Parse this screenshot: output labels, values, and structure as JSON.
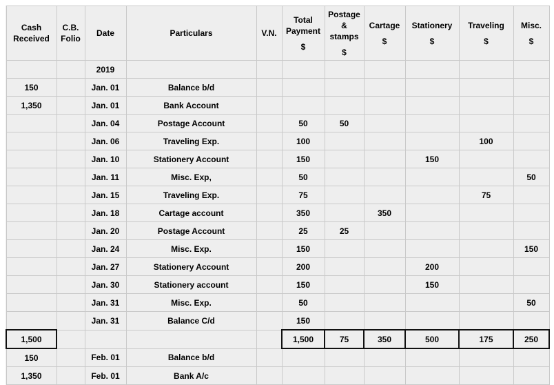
{
  "document": {
    "type": "petty-cash-book",
    "year_marker": "2019"
  },
  "colors": {
    "cell_background": "#eeeeee",
    "grid_line": "#c9c9c9",
    "heavy_rule": "#111111",
    "text": "#000000",
    "page_background": "#ffffff"
  },
  "columns": [
    {
      "key": "cash_received",
      "line1": "Cash",
      "line2": "Received",
      "line3": "",
      "currency": ""
    },
    {
      "key": "cb_folio",
      "line1": "C.B.",
      "line2": "Folio",
      "line3": "",
      "currency": ""
    },
    {
      "key": "date",
      "line1": "Date",
      "line2": "",
      "line3": "",
      "currency": ""
    },
    {
      "key": "particulars",
      "line1": "Particulars",
      "line2": "",
      "line3": "",
      "currency": ""
    },
    {
      "key": "vn",
      "line1": "V.N.",
      "line2": "",
      "line3": "",
      "currency": ""
    },
    {
      "key": "total_payment",
      "line1": "Total",
      "line2": "Payment",
      "line3": "",
      "currency": "$"
    },
    {
      "key": "postage",
      "line1": "Postage",
      "line2": "&",
      "line3": "stamps",
      "currency": "$"
    },
    {
      "key": "cartage",
      "line1": "Cartage",
      "line2": "",
      "line3": "",
      "currency": "$"
    },
    {
      "key": "stationery",
      "line1": "Stationery",
      "line2": "",
      "line3": "",
      "currency": "$"
    },
    {
      "key": "traveling",
      "line1": "Traveling",
      "line2": "",
      "line3": "",
      "currency": "$"
    },
    {
      "key": "misc",
      "line1": "Misc.",
      "line2": "",
      "line3": "",
      "currency": "$"
    }
  ],
  "rows": [
    {
      "cash_received": "",
      "cb_folio": "",
      "date": "2019",
      "particulars": "",
      "vn": "",
      "total_payment": "",
      "postage": "",
      "cartage": "",
      "stationery": "",
      "traveling": "",
      "misc": "",
      "style": "normal"
    },
    {
      "cash_received": "150",
      "cb_folio": "",
      "date": "Jan. 01",
      "particulars": "Balance b/d",
      "vn": "",
      "total_payment": "",
      "postage": "",
      "cartage": "",
      "stationery": "",
      "traveling": "",
      "misc": "",
      "style": "normal"
    },
    {
      "cash_received": "1,350",
      "cb_folio": "",
      "date": "Jan. 01",
      "particulars": "Bank Account",
      "vn": "",
      "total_payment": "",
      "postage": "",
      "cartage": "",
      "stationery": "",
      "traveling": "",
      "misc": "",
      "style": "normal"
    },
    {
      "cash_received": "",
      "cb_folio": "",
      "date": "Jan. 04",
      "particulars": "Postage Account",
      "vn": "",
      "total_payment": "50",
      "postage": "50",
      "cartage": "",
      "stationery": "",
      "traveling": "",
      "misc": "",
      "style": "normal"
    },
    {
      "cash_received": "",
      "cb_folio": "",
      "date": "Jan. 06",
      "particulars": "Traveling Exp.",
      "vn": "",
      "total_payment": "100",
      "postage": "",
      "cartage": "",
      "stationery": "",
      "traveling": "100",
      "misc": "",
      "style": "normal"
    },
    {
      "cash_received": "",
      "cb_folio": "",
      "date": "Jan. 10",
      "particulars": "Stationery Account",
      "vn": "",
      "total_payment": "150",
      "postage": "",
      "cartage": "",
      "stationery": "150",
      "traveling": "",
      "misc": "",
      "style": "normal"
    },
    {
      "cash_received": "",
      "cb_folio": "",
      "date": "Jan. 11",
      "particulars": "Misc. Exp,",
      "vn": "",
      "total_payment": "50",
      "postage": "",
      "cartage": "",
      "stationery": "",
      "traveling": "",
      "misc": "50",
      "style": "normal"
    },
    {
      "cash_received": "",
      "cb_folio": "",
      "date": "Jan. 15",
      "particulars": "Traveling Exp.",
      "vn": "",
      "total_payment": "75",
      "postage": "",
      "cartage": "",
      "stationery": "",
      "traveling": "75",
      "misc": "",
      "style": "normal"
    },
    {
      "cash_received": "",
      "cb_folio": "",
      "date": "Jan. 18",
      "particulars": "Cartage account",
      "vn": "",
      "total_payment": "350",
      "postage": "",
      "cartage": "350",
      "stationery": "",
      "traveling": "",
      "misc": "",
      "style": "normal"
    },
    {
      "cash_received": "",
      "cb_folio": "",
      "date": "Jan. 20",
      "particulars": "Postage Account",
      "vn": "",
      "total_payment": "25",
      "postage": "25",
      "cartage": "",
      "stationery": "",
      "traveling": "",
      "misc": "",
      "style": "normal"
    },
    {
      "cash_received": "",
      "cb_folio": "",
      "date": "Jan. 24",
      "particulars": "Misc. Exp.",
      "vn": "",
      "total_payment": "150",
      "postage": "",
      "cartage": "",
      "stationery": "",
      "traveling": "",
      "misc": "150",
      "style": "normal"
    },
    {
      "cash_received": "",
      "cb_folio": "",
      "date": "Jan. 27",
      "particulars": "Stationery Account",
      "vn": "",
      "total_payment": "200",
      "postage": "",
      "cartage": "",
      "stationery": "200",
      "traveling": "",
      "misc": "",
      "style": "normal"
    },
    {
      "cash_received": "",
      "cb_folio": "",
      "date": "Jan. 30",
      "particulars": "Stationery account",
      "vn": "",
      "total_payment": "150",
      "postage": "",
      "cartage": "",
      "stationery": "150",
      "traveling": "",
      "misc": "",
      "style": "normal"
    },
    {
      "cash_received": "",
      "cb_folio": "",
      "date": "Jan. 31",
      "particulars": "Misc. Exp.",
      "vn": "",
      "total_payment": "50",
      "postage": "",
      "cartage": "",
      "stationery": "",
      "traveling": "",
      "misc": "50",
      "style": "normal"
    },
    {
      "cash_received": "",
      "cb_folio": "",
      "date": "Jan. 31",
      "particulars": "Balance C/d",
      "vn": "",
      "total_payment": "150",
      "postage": "",
      "cartage": "",
      "stationery": "",
      "traveling": "",
      "misc": "",
      "style": "normal"
    },
    {
      "cash_received": "1,500",
      "cb_folio": "",
      "date": "",
      "particulars": "",
      "vn": "",
      "total_payment": "1,500",
      "postage": "75",
      "cartage": "350",
      "stationery": "500",
      "traveling": "175",
      "misc": "250",
      "style": "total"
    },
    {
      "cash_received": "150",
      "cb_folio": "",
      "date": "Feb. 01",
      "particulars": "Balance b/d",
      "vn": "",
      "total_payment": "",
      "postage": "",
      "cartage": "",
      "stationery": "",
      "traveling": "",
      "misc": "",
      "style": "normal"
    },
    {
      "cash_received": "1,350",
      "cb_folio": "",
      "date": "Feb. 01",
      "particulars": "Bank A/c",
      "vn": "",
      "total_payment": "",
      "postage": "",
      "cartage": "",
      "stationery": "",
      "traveling": "",
      "misc": "",
      "style": "normal"
    }
  ],
  "totals": {
    "cash_received": "1,500",
    "total_payment": "1,500",
    "postage": "75",
    "cartage": "350",
    "stationery": "500",
    "traveling": "175",
    "misc": "250"
  }
}
